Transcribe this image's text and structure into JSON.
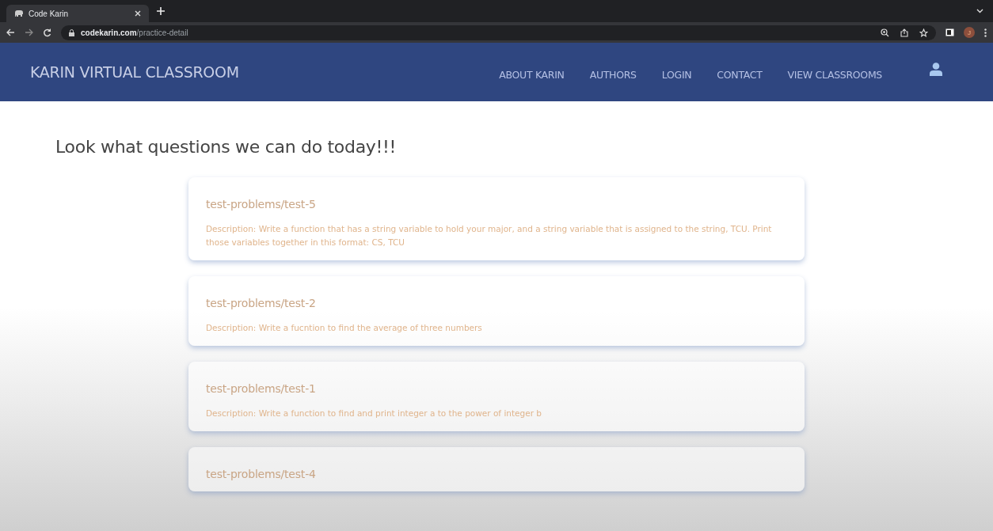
{
  "browser": {
    "tab_title": "Code Karin",
    "url": "**codekarin.com**/practice-detail",
    "profile_initial": "J"
  },
  "navbar": {
    "brand": "KARIN VIRTUAL CLASSROOM",
    "links": [
      "ABOUT KARIN",
      "AUTHORS",
      "LOGIN",
      "CONTACT",
      "VIEW CLASSROOMS"
    ]
  },
  "heading": "Look what questions we can do today!!!",
  "problems": [
    {
      "title": "test-problems/test-5",
      "description": "Description: Write a function that has a string variable to hold your major, and a string variable that is assigned to the string, TCU. Print those variables together in this format: CS, TCU"
    },
    {
      "title": "test-problems/test-2",
      "description": "Description: Write a fucntion to find the average of three numbers"
    },
    {
      "title": "test-problems/test-1",
      "description": "Description: Write a function to find and print integer a to the power of integer b"
    },
    {
      "title": "test-problems/test-4"
    }
  ]
}
